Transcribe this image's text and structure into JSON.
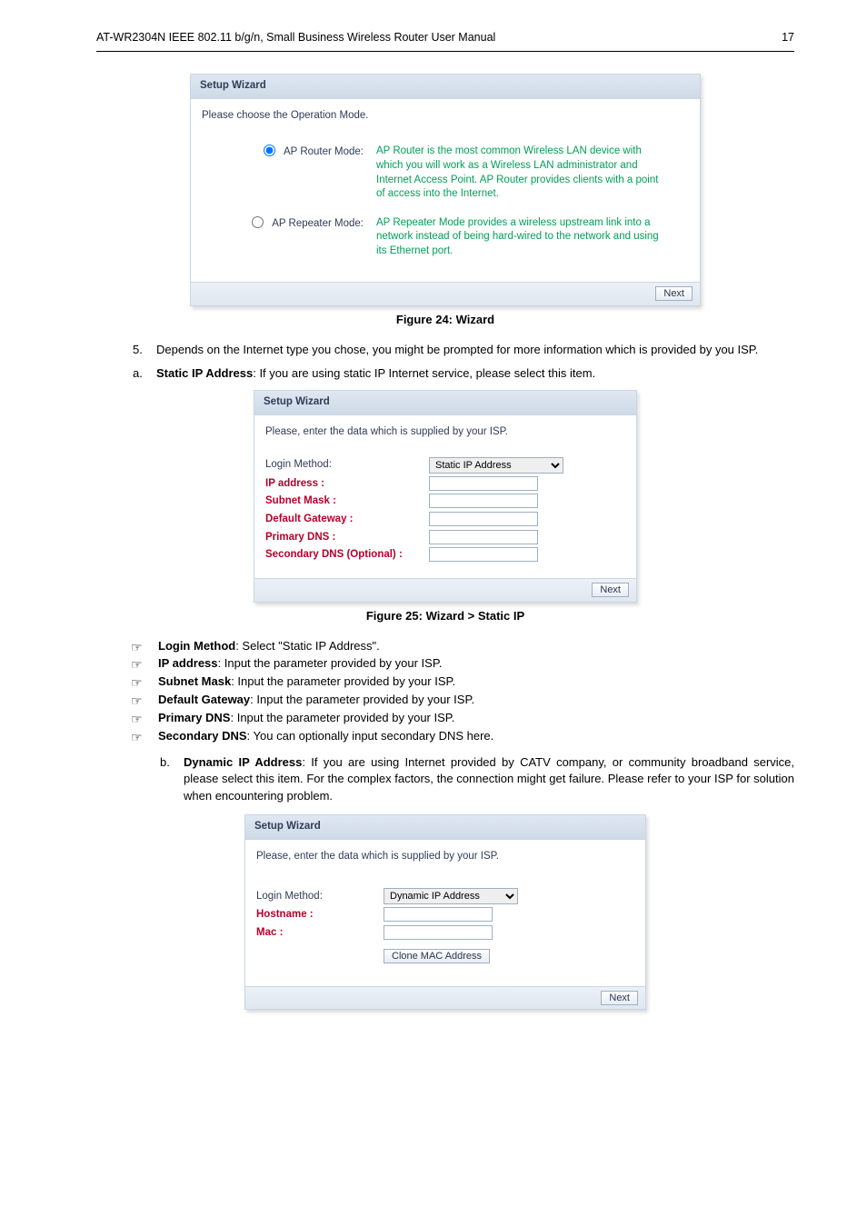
{
  "header": {
    "title": "AT-WR2304N IEEE 802.11 b/g/n, Small Business Wireless Router User Manual",
    "page": "17"
  },
  "fig24": {
    "caption_prefix": "Figure 24: ",
    "caption": "Wizard",
    "panel_title": "Setup Wizard",
    "subtitle": "Please choose the Operation Mode.",
    "opt1_label": "AP Router Mode:",
    "opt1_text": "AP Router is the most common Wireless LAN device with which you will work as a Wireless LAN administrator and Internet Access Point. AP Router provides clients with a point of access into the Internet.",
    "opt2_label": "AP Repeater Mode:",
    "opt2_text": "AP Repeater Mode provides a wireless upstream link into a network instead of being hard-wired to the network and using its Ethernet port.",
    "next": "Next"
  },
  "after24": {
    "li5": "Depends on the Internet type you chose, you might be prompted for more information which is provided by you ISP.",
    "liA_lead": "Static IP Address",
    "liA_rest": ": If you are using static IP Internet service, please select this item."
  },
  "fig25": {
    "caption_prefix": "Figure 25: ",
    "caption": "Wizard > Static IP",
    "panel_title": "Setup Wizard",
    "subtitle": "Please, enter the data which is supplied by your ISP.",
    "rows": {
      "login": "Login Method:",
      "login_val": "Static IP Address",
      "ip": "IP address :",
      "mask": "Subnet Mask :",
      "gw": "Default Gateway :",
      "pdns": "Primary DNS :",
      "sdns": "Secondary DNS (Optional) :"
    },
    "next": "Next"
  },
  "bullets": {
    "b1a": "Login Method",
    "b1b": ": Select \"Static IP Address\".",
    "b2a": "IP address",
    "b2b": ": Input the parameter provided by your ISP.",
    "b3a": "Subnet Mask",
    "b3b": ": Input the parameter provided by your ISP.",
    "b4a": "Default Gateway",
    "b4b": ": Input the parameter provided by your ISP.",
    "b5a": "Primary DNS",
    "b5b": ": Input the parameter provided by your ISP.",
    "b6a": "Secondary DNS",
    "b6b": ": You can optionally input secondary DNS here."
  },
  "liB": {
    "lead": "Dynamic IP Address",
    "rest": ": If you are using Internet provided by CATV company, or community broadband service, please select this item. For the complex factors, the connection might get failure. Please refer to your ISP for solution when encountering problem."
  },
  "fig26": {
    "panel_title": "Setup Wizard",
    "subtitle": "Please, enter the data which is supplied by your ISP.",
    "login": "Login Method:",
    "login_val": "Dynamic IP Address",
    "host": "Hostname :",
    "mac": "Mac :",
    "clone": "Clone MAC Address",
    "next": "Next"
  }
}
